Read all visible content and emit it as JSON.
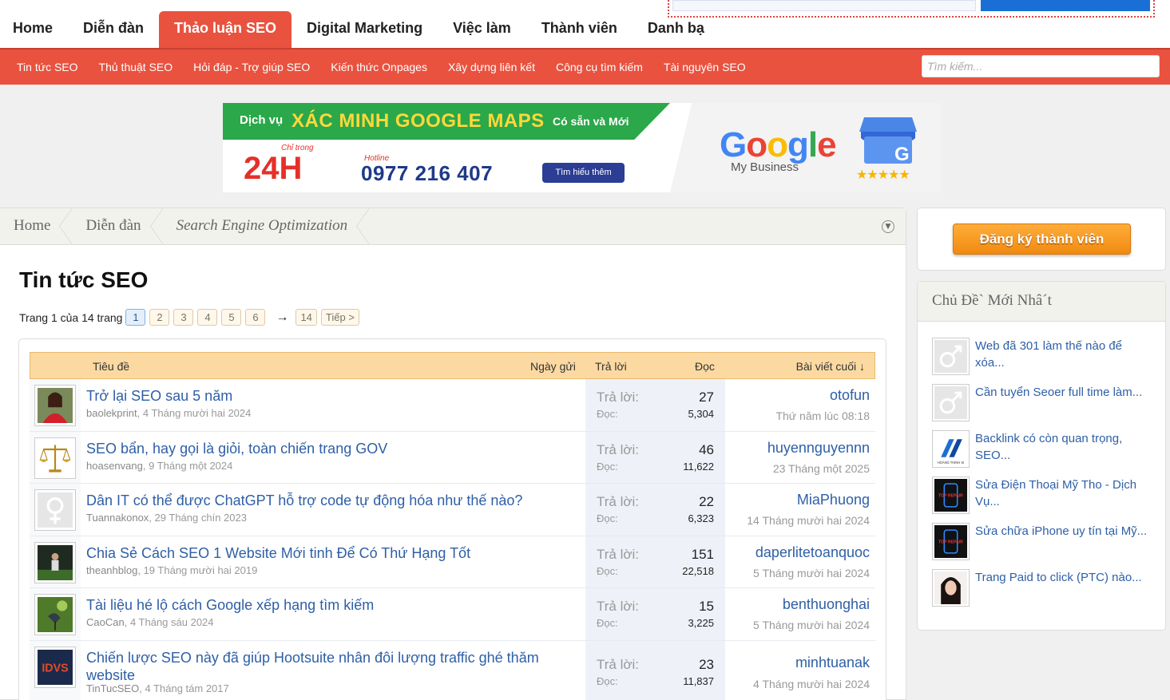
{
  "top_nav": {
    "tabs": [
      {
        "label": "Home",
        "active": false
      },
      {
        "label": "Diễn đàn",
        "active": false
      },
      {
        "label": "Thảo luận SEO",
        "active": true
      },
      {
        "label": "Digital Marketing",
        "active": false
      },
      {
        "label": "Việc làm",
        "active": false
      },
      {
        "label": "Thành viên",
        "active": false
      },
      {
        "label": "Danh bạ",
        "active": false
      }
    ]
  },
  "sub_nav": {
    "items": [
      "Tin tức SEO",
      "Thủ thuật SEO",
      "Hỏi đáp - Trợ giúp SEO",
      "Kiến thức Onpages",
      "Xây dựng liên kết",
      "Công cụ tìm kiếm",
      "Tài nguyên SEO"
    ],
    "search_placeholder": "Tìm kiếm..."
  },
  "banner": {
    "line1_prefix": "Dịch vụ",
    "line1_main": "XÁC MINH GOOGLE MAPS",
    "line1_suffix": "Có sẵn và Mới",
    "chi_trong": "Chỉ trong",
    "hours": "24H",
    "hotline_label": "Hotline",
    "phone": "0977 216 407",
    "button": "Tìm hiểu thêm",
    "brand": "Google",
    "brand_sub": "My Business",
    "stars": "★★★★★",
    "icon_letter": "G"
  },
  "breadcrumb": [
    "Home",
    "Diễn đàn",
    "Search Engine Optimization"
  ],
  "page_title": "Tin tức SEO",
  "pager": {
    "label": "Trang 1 của 14 trang",
    "pages": [
      "1",
      "2",
      "3",
      "4",
      "5",
      "6"
    ],
    "current": "1",
    "arrow": "→",
    "last": "14",
    "next": "Tiếp >"
  },
  "table_header": {
    "title": "Tiêu đề",
    "date": "Ngày gửi",
    "replies": "Trả lời",
    "views": "Đọc",
    "last_post": "Bài viết cuối ↓"
  },
  "labels": {
    "replies": "Trả lời:",
    "views": "Đọc:"
  },
  "threads": [
    {
      "title": "Trở lại SEO sau 5 năm",
      "author": "baolekprint",
      "date": "4 Tháng mười hai 2024",
      "replies": "27",
      "views": "5,304",
      "last_user": "otofun",
      "last_date": "Thứ năm lúc 08:18",
      "avatar": "avatar-woman-red"
    },
    {
      "title": "SEO bẩn, hay gọi là giỏi, toàn chiến trang GOV",
      "author": "hoasenvang",
      "date": "9 Tháng một 2024",
      "replies": "46",
      "views": "11,622",
      "last_user": "huyennguyennn",
      "last_date": "23 Tháng một 2025",
      "avatar": "scales-icon"
    },
    {
      "title": "Dân IT có thể được ChatGPT hỗ trợ code tự động hóa như thế nào?",
      "author": "Tuannakonox",
      "date": "29 Tháng chín 2023",
      "replies": "22",
      "views": "6,323",
      "last_user": "MiaPhuong",
      "last_date": "14 Tháng mười hai 2024",
      "avatar": "female-default-icon"
    },
    {
      "title": "Chia Sẻ Cách SEO 1 Website Mới tinh Để Có Thứ Hạng Tốt",
      "author": "theanhblog",
      "date": "19 Tháng mười hai 2019",
      "replies": "151",
      "views": "22,518",
      "last_user": "daperlitetoanquoc",
      "last_date": "5 Tháng mười hai 2024",
      "avatar": "avatar-night-person"
    },
    {
      "title": "Tài liệu hé lộ cách Google xếp hạng tìm kiếm",
      "author": "CaoCan",
      "date": "4 Tháng sáu 2024",
      "replies": "15",
      "views": "3,225",
      "last_user": "benthuonghai",
      "last_date": "5 Tháng mười hai 2024",
      "avatar": "avatar-bird"
    },
    {
      "title": "Chiến lược SEO này đã giúp Hootsuite nhân đôi lượng traffic ghé thăm website",
      "author": "TinTucSEO",
      "date": "4 Tháng tám 2017",
      "replies": "23",
      "views": "11,837",
      "last_user": "minhtuanak",
      "last_date": "4 Tháng mười hai 2024",
      "avatar": "idvs-logo",
      "avatar_text": "IDVS"
    }
  ],
  "sidebar": {
    "register_button": "Đăng ký thành viên",
    "recent_title": "Chủ Đề` Mới Nhâ´t",
    "recent": [
      {
        "title": "Web đã 301 làm thế nào để xóa...",
        "avatar": "male-default-icon"
      },
      {
        "title": "Cần tuyển Seoer full time làm...",
        "avatar": "male-default-icon"
      },
      {
        "title": "Backlink có còn quan trọng, SEO...",
        "avatar": "hoang-thinh-logo",
        "avatar_text": "HOÀNG THỊNH SI"
      },
      {
        "title": "Sửa Điện Thoại Mỹ Tho - Dịch Vụ...",
        "avatar": "top-repair-logo",
        "avatar_text": "TOP REPAIR"
      },
      {
        "title": "Sửa chữa iPhone uy tín tại Mỹ...",
        "avatar": "top-repair-logo",
        "avatar_text": "TOP REPAIR"
      },
      {
        "title": "Trang Paid to click (PTC) nào...",
        "avatar": "avatar-woman-face"
      }
    ]
  },
  "colors": {
    "accent": "#e9523f",
    "link": "#2e5fa6",
    "header_row": "#fbd9a1",
    "register": "#f08a10"
  }
}
